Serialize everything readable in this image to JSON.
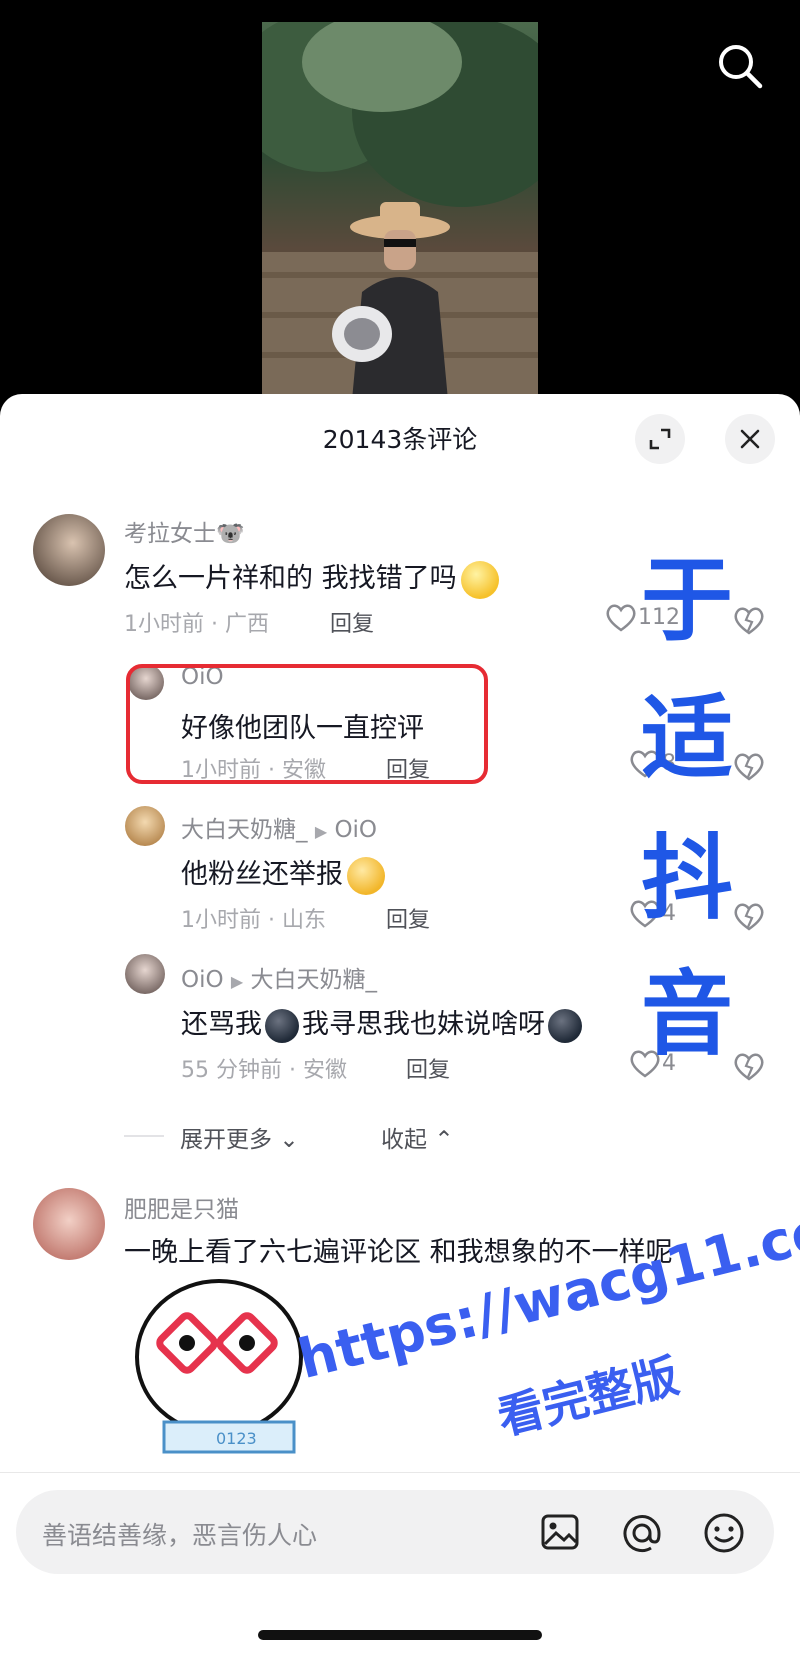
{
  "header": {
    "comment_count_title": "20143条评论"
  },
  "comments": [
    {
      "user": "考拉女士🐨",
      "text": "怎么一片祥和的 我找错了吗",
      "time_location": "1小时前 · 广西",
      "reply": "回复",
      "likes": "112"
    },
    {
      "user": "OiO",
      "text": "好像他团队一直控评",
      "time_location": "1小时前 · 安徽",
      "reply": "回复",
      "likes": "8"
    },
    {
      "user": "大白天奶糖_",
      "reply_to": "OiO",
      "text": "他粉丝还举报",
      "time_location": "1小时前 · 山东",
      "reply": "回复",
      "likes": "4"
    },
    {
      "user": "OiO",
      "reply_to": "大白天奶糖_",
      "text_a": "还骂我",
      "text_b": "我寻思我也妹说啥呀",
      "time_location": "55 分钟前 · 安徽",
      "reply": "回复",
      "likes": "4"
    },
    {
      "user": "肥肥是只猫",
      "text": "一晚上看了六七遍评论区 和我想象的不一样呢",
      "sticker_label": "0123"
    }
  ],
  "thread_controls": {
    "expand": "展开更多",
    "collapse": "收起"
  },
  "input": {
    "placeholder": "善语结善缘，恶言伤人心"
  },
  "watermarks": {
    "vertical": [
      "于",
      "适",
      "抖",
      "音"
    ],
    "url": "https://wacg11.com",
    "url_sub": "看完整版"
  },
  "colors": {
    "accent_watermark": "#1f57e6",
    "highlight_box": "#e62b33",
    "text_primary": "#161823",
    "text_secondary": "#8a8b91"
  }
}
